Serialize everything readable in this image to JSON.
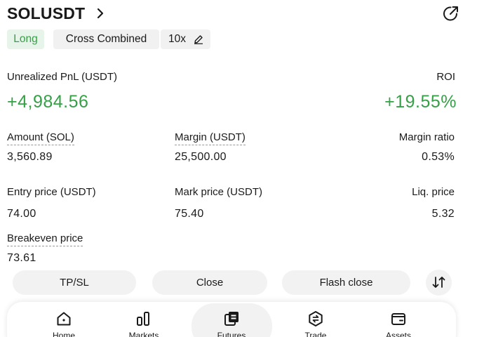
{
  "header": {
    "symbol": "SOLUSDT"
  },
  "tags": {
    "side": "Long",
    "margin_mode": "Cross Combined",
    "leverage": "10x"
  },
  "pnl": {
    "label": "Unrealized PnL (USDT)",
    "value": "+4,984.56",
    "roi_label": "ROI",
    "roi_value": "+19.55%"
  },
  "stats": {
    "amount_label": "Amount (SOL)",
    "amount_value": "3,560.89",
    "margin_label": "Margin (USDT)",
    "margin_value": "25,500.00",
    "ratio_label": "Margin ratio",
    "ratio_value": "0.53%",
    "entry_label": "Entry price (USDT)",
    "entry_value": "74.00",
    "mark_label": "Mark price (USDT)",
    "mark_value": "75.40",
    "liq_label": "Liq. price",
    "liq_value": "5.32",
    "breakeven_label": "Breakeven price",
    "breakeven_value": "73.61"
  },
  "actions": {
    "tpsl": "TP/SL",
    "close": "Close",
    "flash_close": "Flash close"
  },
  "nav": {
    "home": "Home",
    "markets": "Markets",
    "futures": "Futures",
    "trade": "Trade",
    "assets": "Assets"
  },
  "colors": {
    "positive": "#35a046",
    "long_bg": "#e6f4e9",
    "chip_bg": "#f2f2f2"
  }
}
